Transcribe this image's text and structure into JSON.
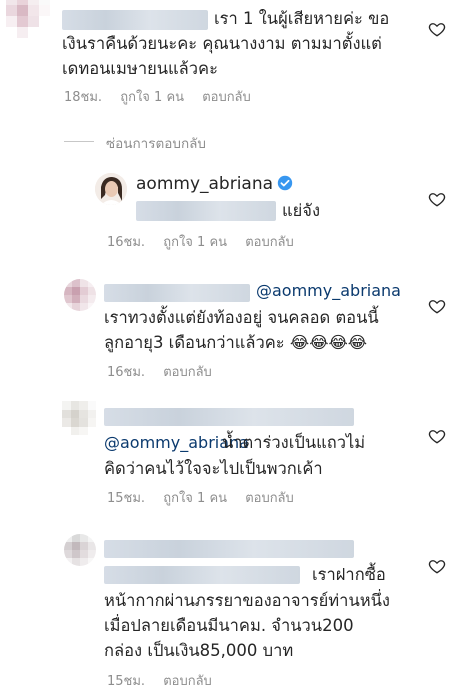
{
  "comments": [
    {
      "line1": "เรา 1 ในผู้เสียหายค่ะ ขอ",
      "line2": "เงินราคืนด้วยนะคะ คุณนางงาม  ตามมาตั้งแต่",
      "line3": "เดทอนเมษายนแล้วคะ",
      "time": "18ชม.",
      "likes": "ถูกใจ 1 คน",
      "reply": "ตอบกลับ"
    }
  ],
  "hide_replies": "ซ่อนการตอบกลับ",
  "reply1": {
    "username": "aommy_abriana",
    "text": "แย่จัง",
    "time": "16ชม.",
    "likes": "ถูกใจ 1 คน",
    "reply": "ตอบกลับ"
  },
  "reply2": {
    "mention": "@aommy_abriana",
    "line1": "เราทวงตั้งแต่ยังท้องอยู่ จนคลอด  ตอนนี้",
    "line2": "ลูกอายุ3 เดือนกว่าแล้วคะ",
    "emoji": "😂😂😂😂",
    "time": "16ชม.",
    "reply": "ตอบกลับ"
  },
  "reply3": {
    "mention": "@aommy_abriana",
    "line1_tail": " น้ำตาร่วงเป็นแถวไม่",
    "line2": "คิดว่าคนไว้ใจจะไปเป็นพวกเค้า",
    "time": "15ชม.",
    "likes": "ถูกใจ 1 คน",
    "reply": "ตอบกลับ"
  },
  "reply4": {
    "line1_tail": "เราฝากซื้อ",
    "line2": "หน้ากากผ่านภรรยาของอาจารย์ท่านหนึ่ง",
    "line3": "เมื่อปลายเดือนมีนาคม. จำนวน200",
    "line4": "กล่อง เป็นเงิน85,000 บาท",
    "time": "15ชม.",
    "reply": "ตอบกลับ"
  },
  "icons": {
    "heart": "heart-outline-icon",
    "verified": "verified-badge-icon"
  },
  "colors": {
    "text": "#262626",
    "meta": "#8e8e8e",
    "mention": "#0b3a6e",
    "verified": "#3897f0"
  }
}
